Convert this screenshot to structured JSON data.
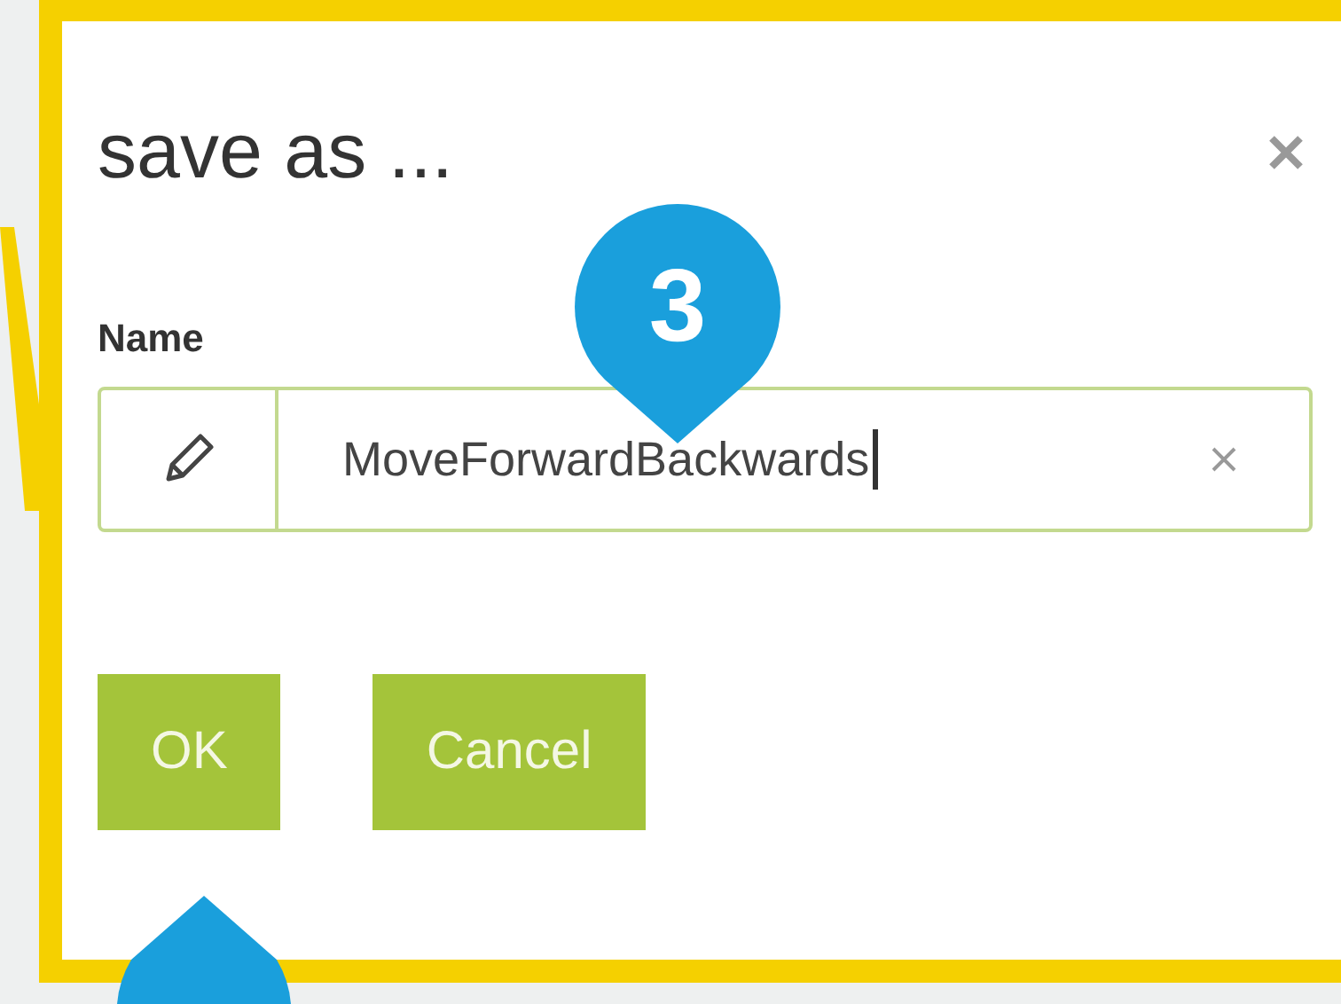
{
  "dialog": {
    "title": "save as ...",
    "field": {
      "label": "Name",
      "value": "MoveForwardBackwards"
    },
    "buttons": [
      {
        "label": "OK"
      },
      {
        "label": "Cancel"
      }
    ]
  },
  "callouts": [
    {
      "number": "3"
    }
  ]
}
